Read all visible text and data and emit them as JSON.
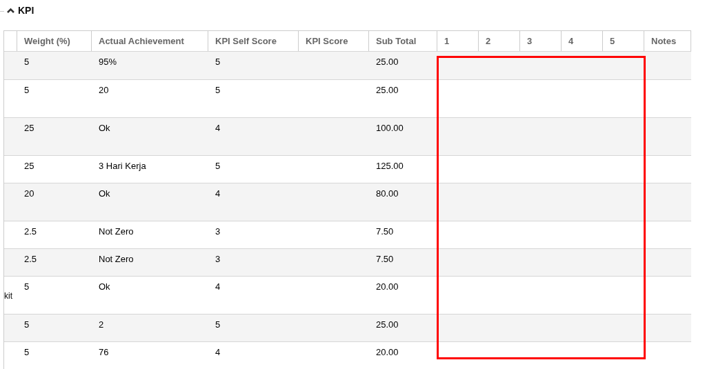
{
  "section": {
    "title": "KPI",
    "expanded": true
  },
  "table": {
    "columns": [
      "",
      "Weight (%)",
      "Actual Achievement",
      "KPI Self Score",
      "KPI Score",
      "Sub Total",
      "1",
      "2",
      "3",
      "4",
      "5",
      "Notes"
    ],
    "rows": [
      {
        "cells": [
          "",
          "5",
          "95%",
          "5",
          "",
          "25.00",
          "",
          "",
          "",
          "",
          "",
          ""
        ]
      },
      {
        "cells": [
          "",
          "5",
          "20",
          "5",
          "",
          "25.00",
          "",
          "",
          "",
          "",
          "",
          ""
        ]
      },
      {
        "cells": [
          "",
          "25",
          "Ok",
          "4",
          "",
          "100.00",
          "",
          "",
          "",
          "",
          "",
          ""
        ]
      },
      {
        "cells": [
          "",
          "25",
          "3 Hari Kerja",
          "5",
          "",
          "125.00",
          "",
          "",
          "",
          "",
          "",
          ""
        ]
      },
      {
        "cells": [
          "",
          "20",
          "Ok",
          "4",
          "",
          "80.00",
          "",
          "",
          "",
          "",
          "",
          ""
        ]
      },
      {
        "cells": [
          "",
          "2.5",
          "Not Zero",
          "3",
          "",
          "7.50",
          "",
          "",
          "",
          "",
          "",
          ""
        ]
      },
      {
        "cells": [
          "",
          "2.5",
          "Not Zero",
          "3",
          "",
          "7.50",
          "",
          "",
          "",
          "",
          "",
          ""
        ]
      },
      {
        "cells": [
          "kit",
          "5",
          "Ok",
          "4",
          "",
          "20.00",
          "",
          "",
          "",
          "",
          "",
          ""
        ]
      },
      {
        "cells": [
          "",
          "5",
          "2",
          "5",
          "",
          "25.00",
          "",
          "",
          "",
          "",
          "",
          ""
        ]
      },
      {
        "cells": [
          "",
          "5",
          "76",
          "4",
          "",
          "20.00",
          "",
          "",
          "",
          "",
          "",
          ""
        ]
      }
    ]
  },
  "annotation": {
    "kind": "rectangle"
  }
}
